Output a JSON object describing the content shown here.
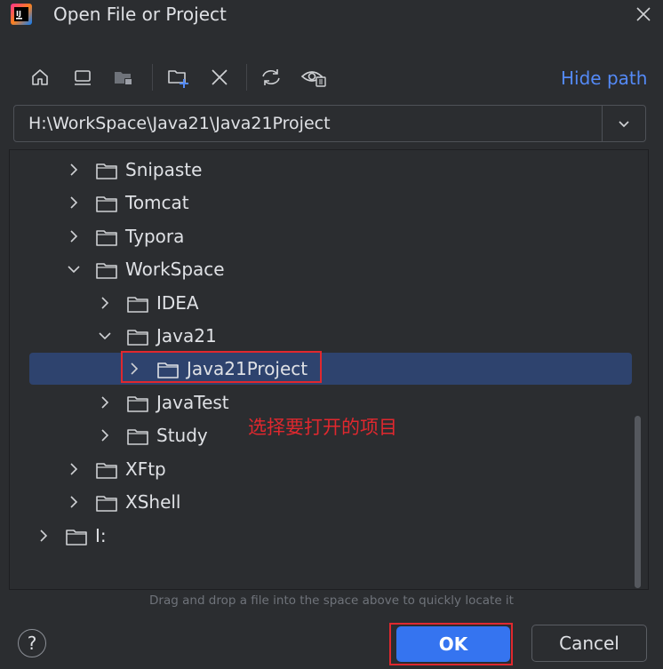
{
  "window": {
    "title": "Open File or Project",
    "close_icon": "close-icon",
    "logo_text": "IJ"
  },
  "toolbar": {
    "buttons": [
      "home-icon",
      "desktop-icon",
      "project-folder-icon",
      "new-folder-icon",
      "delete-icon",
      "refresh-icon",
      "show-hidden-icon"
    ],
    "hide_path_label": "Hide path"
  },
  "path": {
    "value": "H:\\WorkSpace\\Java21\\Java21Project"
  },
  "tree": {
    "items": [
      {
        "label": "Snipaste",
        "level": 1,
        "expanded": false,
        "selected": false
      },
      {
        "label": "Tomcat",
        "level": 1,
        "expanded": false,
        "selected": false
      },
      {
        "label": "Typora",
        "level": 1,
        "expanded": false,
        "selected": false
      },
      {
        "label": "WorkSpace",
        "level": 1,
        "expanded": true,
        "selected": false
      },
      {
        "label": "IDEA",
        "level": 2,
        "expanded": false,
        "selected": false
      },
      {
        "label": "Java21",
        "level": 2,
        "expanded": true,
        "selected": false
      },
      {
        "label": "Java21Project",
        "level": 3,
        "expanded": false,
        "selected": true
      },
      {
        "label": "JavaTest",
        "level": 2,
        "expanded": false,
        "selected": false
      },
      {
        "label": "Study",
        "level": 2,
        "expanded": false,
        "selected": false
      },
      {
        "label": "XFtp",
        "level": 1,
        "expanded": false,
        "selected": false
      },
      {
        "label": "XShell",
        "level": 1,
        "expanded": false,
        "selected": false
      },
      {
        "label": "I:",
        "level": 0,
        "expanded": false,
        "selected": false
      }
    ]
  },
  "annotation": {
    "text": "选择要打开的项目"
  },
  "hint": "Drag and drop a file into the space above to quickly locate it",
  "footer": {
    "help_label": "?",
    "ok_label": "OK",
    "cancel_label": "Cancel"
  },
  "colors": {
    "accent": "#3574f0",
    "selection": "#2e436e",
    "annotation_red": "#e0282e",
    "link": "#548af7",
    "background": "#2b2d30"
  }
}
